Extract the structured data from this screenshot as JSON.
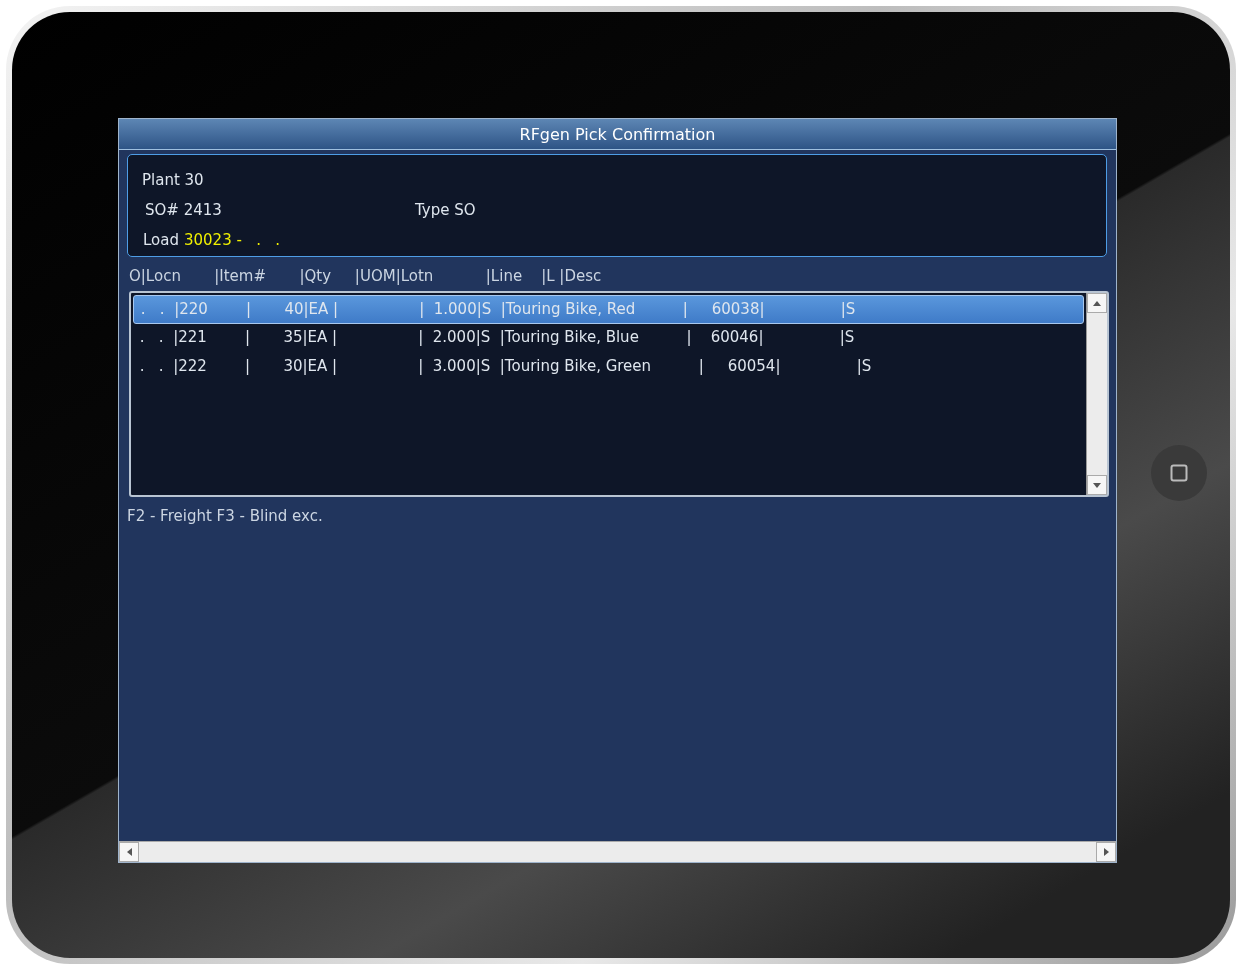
{
  "window": {
    "title": "RFgen Pick Confirmation"
  },
  "info": {
    "plant": {
      "label": "Plant",
      "value": "30"
    },
    "so": {
      "label": "SO#",
      "value": "2413"
    },
    "type": {
      "label": "Type",
      "value": "SO"
    },
    "load": {
      "label": "Load",
      "value": "30023 -   .   ."
    }
  },
  "list_header": "O|Locn       |Item#       |Qty     |UOM|Lotn           |Line    |L |Desc",
  "rows": [
    {
      "text": " .   .  |220        |       40|EA |                 |  1.000|S  |Touring Bike, Red          |     60038|                |S",
      "selected": true
    },
    {
      "text": " .   .  |221        |       35|EA |                 |  2.000|S  |Touring Bike, Blue          |    60046|                |S",
      "selected": false
    },
    {
      "text": " .   .  |222        |       30|EA |                 |  3.000|S  |Touring Bike, Green          |     60054|                |S",
      "selected": false
    }
  ],
  "footer": "F2 - Freight  F3 - Blind exc."
}
